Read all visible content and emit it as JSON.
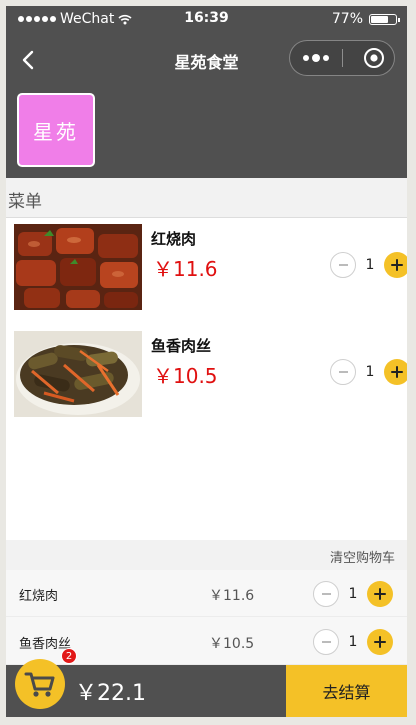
{
  "statusbar": {
    "carrier": "WeChat",
    "time": "16:39",
    "battery": "77%",
    "battery_level": 0.77
  },
  "navbar": {
    "title": "星苑食堂"
  },
  "shop": {
    "logo_text": "星苑"
  },
  "menu": {
    "header": "菜单",
    "items": [
      {
        "name": "红烧肉",
        "price": "￥11.6",
        "qty": "1",
        "photo_icon": "braised-pork-photo"
      },
      {
        "name": "鱼香肉丝",
        "price": "￥10.5",
        "qty": "1",
        "photo_icon": "yuxiang-pork-photo"
      }
    ]
  },
  "cart": {
    "clear_label": "清空购物车",
    "items": [
      {
        "name": "红烧肉",
        "price": "￥11.6",
        "qty": "1"
      },
      {
        "name": "鱼香肉丝",
        "price": "￥10.5",
        "qty": "1"
      }
    ],
    "badge_count": "2",
    "total": "￥22.1",
    "checkout_label": "去结算"
  },
  "colors": {
    "bar_bg": "#505050",
    "accent_yellow": "#f4c127",
    "price_red": "#e01010",
    "logo_pink": "#f07ee8",
    "badge_red": "#e21818"
  }
}
